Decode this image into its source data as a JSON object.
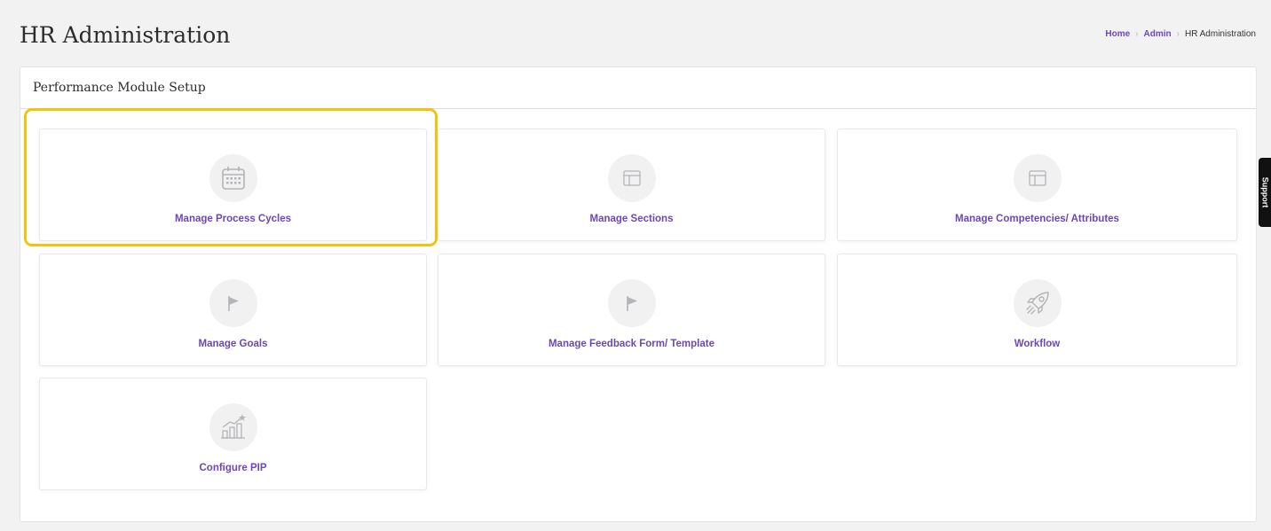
{
  "header": {
    "title": "HR Administration"
  },
  "breadcrumb": {
    "items": [
      {
        "label": "Home"
      },
      {
        "label": "Admin"
      },
      {
        "label": "HR Administration"
      }
    ]
  },
  "panel": {
    "title": "Performance Module Setup"
  },
  "cards": [
    {
      "label": "Manage Process Cycles",
      "icon": "calendar-icon",
      "highlighted": true
    },
    {
      "label": "Manage Sections",
      "icon": "layout-icon"
    },
    {
      "label": "Manage Competencies/ Attributes",
      "icon": "layout-icon"
    },
    {
      "label": "Manage Goals",
      "icon": "flag-icon"
    },
    {
      "label": "Manage Feedback Form/ Template",
      "icon": "flag-icon"
    },
    {
      "label": "Workflow",
      "icon": "rocket-icon"
    },
    {
      "label": "Configure PIP",
      "icon": "growth-chart-icon"
    }
  ],
  "support": {
    "label": "Support"
  },
  "colors": {
    "accent": "#6c47b8",
    "highlight": "#f2c311",
    "icon": "#b4b4b8"
  }
}
